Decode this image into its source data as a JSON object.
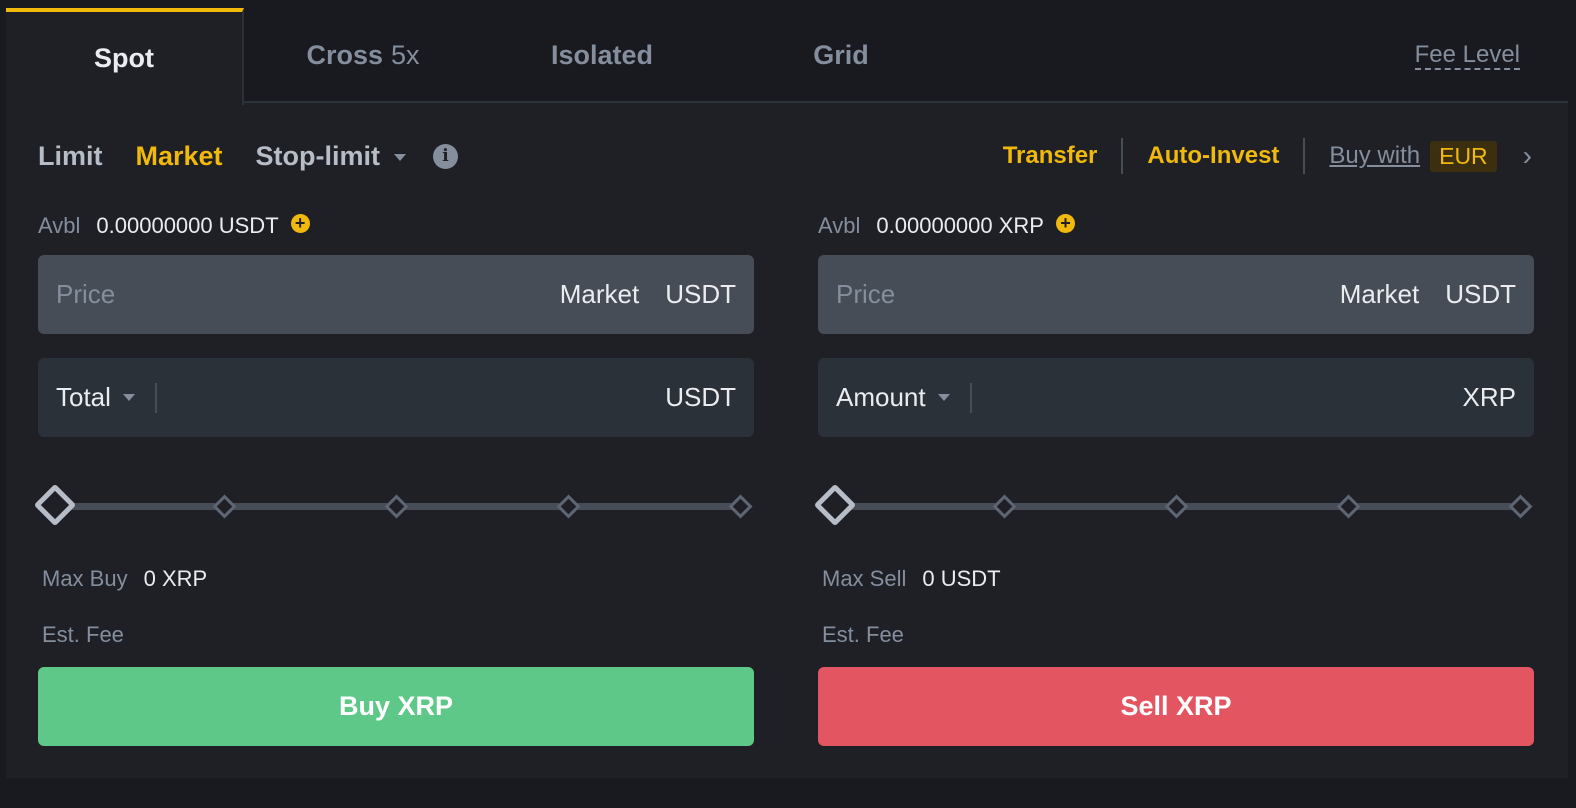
{
  "tabs": {
    "spot": "Spot",
    "cross": "Cross",
    "cross_leverage": "5x",
    "isolated": "Isolated",
    "grid": "Grid",
    "fee_level": "Fee Level"
  },
  "order_types": {
    "limit": "Limit",
    "market": "Market",
    "stop_limit": "Stop-limit",
    "info_icon_glyph": "i",
    "active": "Market"
  },
  "links": {
    "transfer": "Transfer",
    "auto_invest": "Auto-Invest",
    "buy_with": "Buy with",
    "currency": "EUR",
    "chevron": "›"
  },
  "buy": {
    "avbl_label": "Avbl",
    "avbl_value": "0.00000000 USDT",
    "price_placeholder": "Price",
    "price_mode": "Market",
    "price_unit": "USDT",
    "amount_selector": "Total",
    "amount_unit": "USDT",
    "slider_percent": 0,
    "max_label": "Max Buy",
    "max_value": "0 XRP",
    "fee_label": "Est. Fee",
    "button": "Buy XRP"
  },
  "sell": {
    "avbl_label": "Avbl",
    "avbl_value": "0.00000000 XRP",
    "price_placeholder": "Price",
    "price_mode": "Market",
    "price_unit": "USDT",
    "amount_selector": "Amount",
    "amount_unit": "XRP",
    "slider_percent": 0,
    "max_label": "Max Sell",
    "max_value": "0 USDT",
    "fee_label": "Est. Fee",
    "button": "Sell XRP"
  },
  "colors": {
    "accent": "#f0b90b",
    "buy": "#5dc887",
    "sell": "#e35561",
    "background": "#1e2026"
  },
  "icons": {
    "plus": "plus-circle-icon",
    "info": "info-icon",
    "caret": "caret-down-icon",
    "chevron": "chevron-right-icon"
  }
}
